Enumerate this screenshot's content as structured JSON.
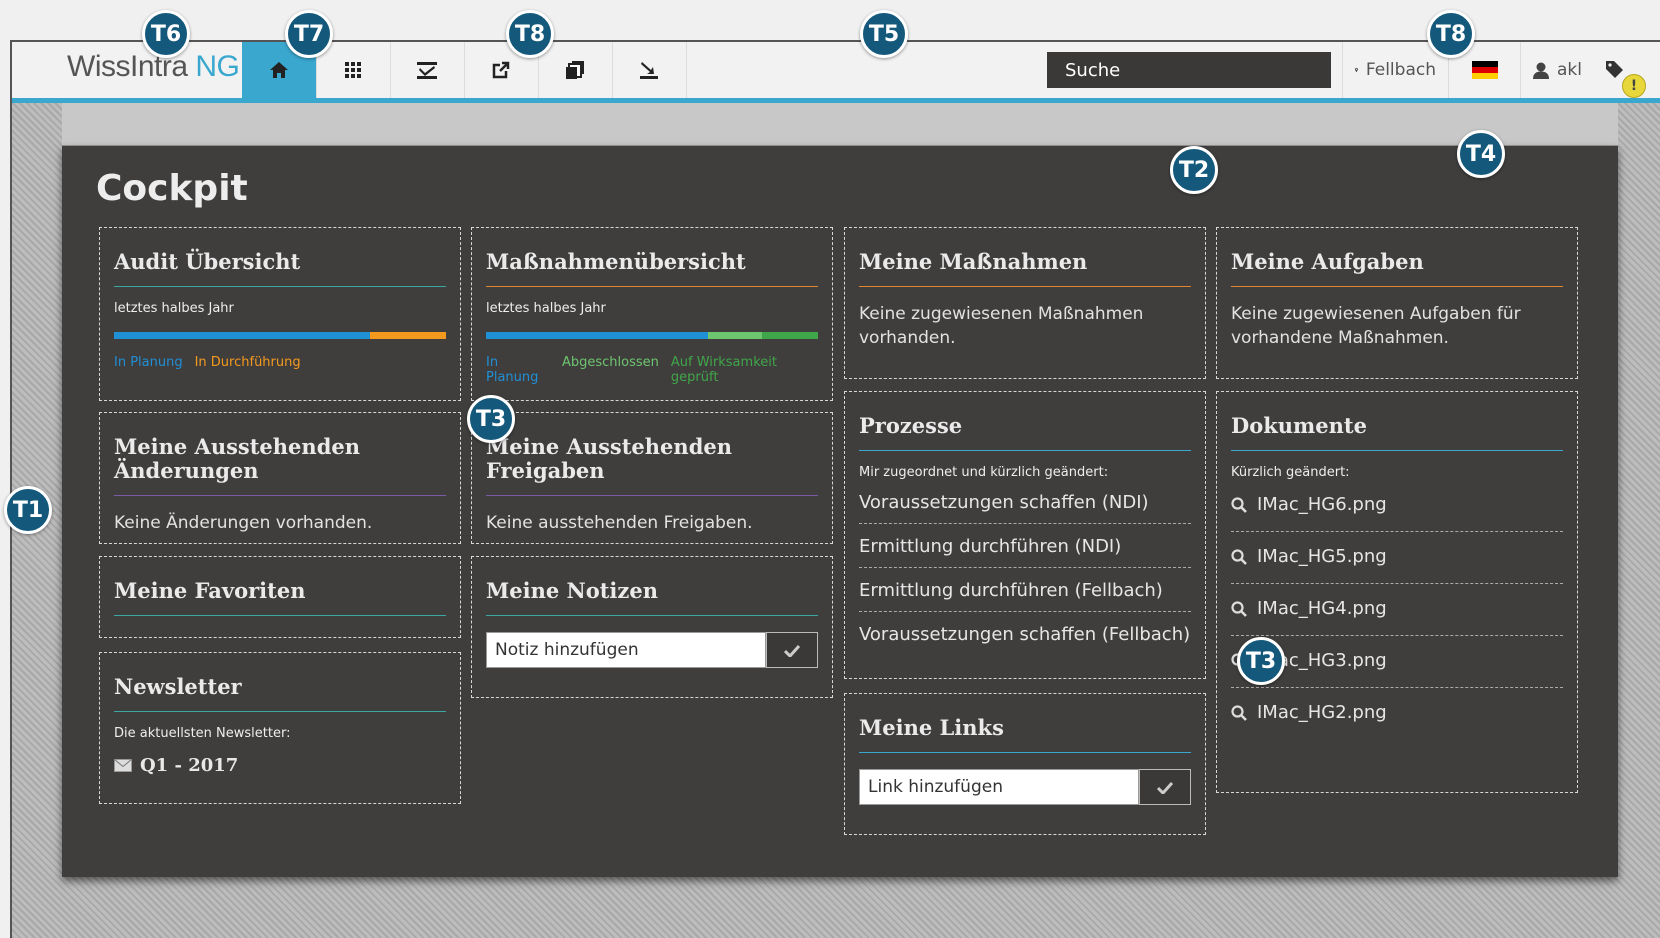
{
  "header": {
    "logo_main": "WissIntra",
    "logo_ng": "NG",
    "search_placeholder": "Suche",
    "location": "Fellbach",
    "user": "akl"
  },
  "nav_icons": [
    "home-icon",
    "grid-icon",
    "checklist-icon",
    "external-link-icon",
    "documents-icon",
    "download-icon"
  ],
  "page": {
    "title": "Cockpit"
  },
  "cards": {
    "audit": {
      "title": "Audit Übersicht",
      "subtitle": "letztes halbes Jahr",
      "bar": [
        {
          "label": "In Planung",
          "fraction": 0.77,
          "color": "#1f8fd6"
        },
        {
          "label": "In Durchführung",
          "fraction": 0.23,
          "color": "#f39a1e"
        }
      ],
      "legend": [
        "In Planung",
        "In Durchführung"
      ]
    },
    "massnahmen_uebersicht": {
      "title": "Maßnahmenübersicht",
      "subtitle": "letztes halbes Jahr",
      "bar": [
        {
          "label": "In Planung",
          "fraction": 0.67,
          "color": "#1f8fd6"
        },
        {
          "label": "Abgeschlossen",
          "fraction": 0.16,
          "color": "#6dc56f"
        },
        {
          "label": "Auf Wirksamkeit geprüft",
          "fraction": 0.17,
          "color": "#3fa64a"
        }
      ],
      "legend": [
        "In Planung",
        "Abgeschlossen",
        "Auf Wirksamkeit geprüft"
      ]
    },
    "meine_massnahmen": {
      "title": "Meine Maßnahmen",
      "text": "Keine zugewiesenen Maßnahmen vorhanden."
    },
    "meine_aufgaben": {
      "title": "Meine Aufgaben",
      "text": "Keine zugewiesenen Aufgaben für vorhandene Maßnahmen."
    },
    "ausstehende_aenderungen": {
      "title": "Meine Ausstehenden Änderungen",
      "text": "Keine Änderungen vorhanden."
    },
    "ausstehende_freigaben": {
      "title": "Meine Ausstehenden Freigaben",
      "text": "Keine ausstehenden Freigaben."
    },
    "prozesse": {
      "title": "Prozesse",
      "subtitle": "Mir zugeordnet und kürzlich geändert:",
      "items": [
        "Voraussetzungen schaffen (NDI)",
        "Ermittlung durchführen (NDI)",
        "Ermittlung durchführen (Fellbach)",
        "Voraussetzungen schaffen (Fellbach)"
      ]
    },
    "dokumente": {
      "title": "Dokumente",
      "subtitle": "Kürzlich geändert:",
      "items": [
        "IMac_HG6.png",
        "IMac_HG5.png",
        "IMac_HG4.png",
        "IMac_HG3.png",
        "IMac_HG2.png"
      ]
    },
    "favoriten": {
      "title": "Meine Favoriten"
    },
    "notizen": {
      "title": "Meine Notizen",
      "placeholder": "Notiz hinzufügen"
    },
    "newsletter": {
      "title": "Newsletter",
      "subtitle": "Die aktuellsten Newsletter:",
      "item": "Q1 - 2017"
    },
    "links": {
      "title": "Meine Links",
      "placeholder": "Link hinzufügen"
    }
  },
  "callouts": [
    "T1",
    "T2",
    "T3",
    "T3",
    "T4",
    "T5",
    "T6",
    "T7",
    "T8",
    "T8"
  ],
  "colors": {
    "accent": "#3aa7cf",
    "panel": "#403e3d",
    "callout": "#14587c"
  }
}
